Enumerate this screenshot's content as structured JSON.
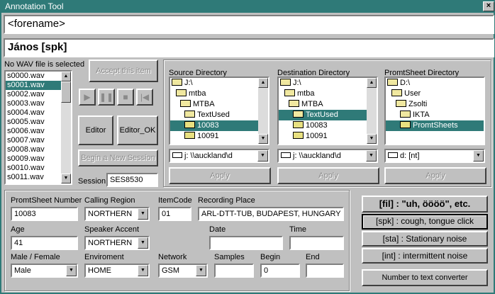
{
  "window": {
    "title": "Annotation Tool",
    "close_glyph": "×"
  },
  "text_lines": {
    "top": "<forename>",
    "bottom": "János [spk]"
  },
  "wav": {
    "status": "No WAV file is selected",
    "files": [
      "s0000.wav",
      "s0001.wav",
      "s0002.wav",
      "s0003.wav",
      "s0004.wav",
      "s0005.wav",
      "s0006.wav",
      "s0007.wav",
      "s0008.wav",
      "s0009.wav",
      "s0010.wav",
      "s0011.wav"
    ],
    "selected_index": 1
  },
  "buttons": {
    "accept": "Accept this item",
    "editor": "Editor",
    "editor_ok": "Editor_OK",
    "new_session": "Begin a New Session",
    "apply": "Apply",
    "number_converter": "Number to text converter"
  },
  "session": {
    "label": "Session",
    "value": "SES8530"
  },
  "media_controls": {
    "play": "▶",
    "pause": "❚❚",
    "stop": "■",
    "rewind": "|◀"
  },
  "source": {
    "label": "Source Directory",
    "items": [
      "J:\\",
      "mtba",
      "MTBA",
      "TextUsed",
      "10083",
      "10091"
    ],
    "selected_index": 4,
    "drive": "j: \\\\auckland\\d"
  },
  "destination": {
    "label": "Destination Directory",
    "items": [
      "J:\\",
      "mtba",
      "MTBA",
      "TextUsed",
      "10083",
      "10091"
    ],
    "selected_index": 3,
    "drive": "j: \\\\auckland\\d"
  },
  "promtsheet_dir": {
    "label": "PromtSheet Directory",
    "items": [
      "D:\\",
      "User",
      "Zsolti",
      "IKTA",
      "PromtSheets"
    ],
    "selected_index": 4,
    "drive": "d: [nt]"
  },
  "form": {
    "promtsheet_number": {
      "label": "PromtSheet Number",
      "value": "10083"
    },
    "calling_region": {
      "label": "Calling Region",
      "value": "NORTHERN"
    },
    "item_code": {
      "label": "ItemCode",
      "value": "01"
    },
    "recording_place": {
      "label": "Recording Place",
      "value": "ARL-DTT-TUB, BUDAPEST, HUNGARY"
    },
    "age": {
      "label": "Age",
      "value": "41"
    },
    "speaker_accent": {
      "label": "Speaker Accent",
      "value": "NORTHERN"
    },
    "date": {
      "label": "Date",
      "value": ""
    },
    "time": {
      "label": "Time",
      "value": ""
    },
    "gender": {
      "label": "Male / Female",
      "value": "Male"
    },
    "environment": {
      "label": "Enviroment",
      "value": "HOME"
    },
    "network": {
      "label": "Network",
      "value": "GSM"
    },
    "samples": {
      "label": "Samples",
      "value": ""
    },
    "begin": {
      "label": "Begin",
      "value": "0"
    },
    "end": {
      "label": "End",
      "value": ""
    }
  },
  "noise_tags": {
    "fil": "[fil] : \"uh, öööö\", etc.",
    "spk": "[spk] : cough, tongue click",
    "sta": "[sta] : Stationary noise",
    "int": "[int] : intermittent noise"
  }
}
